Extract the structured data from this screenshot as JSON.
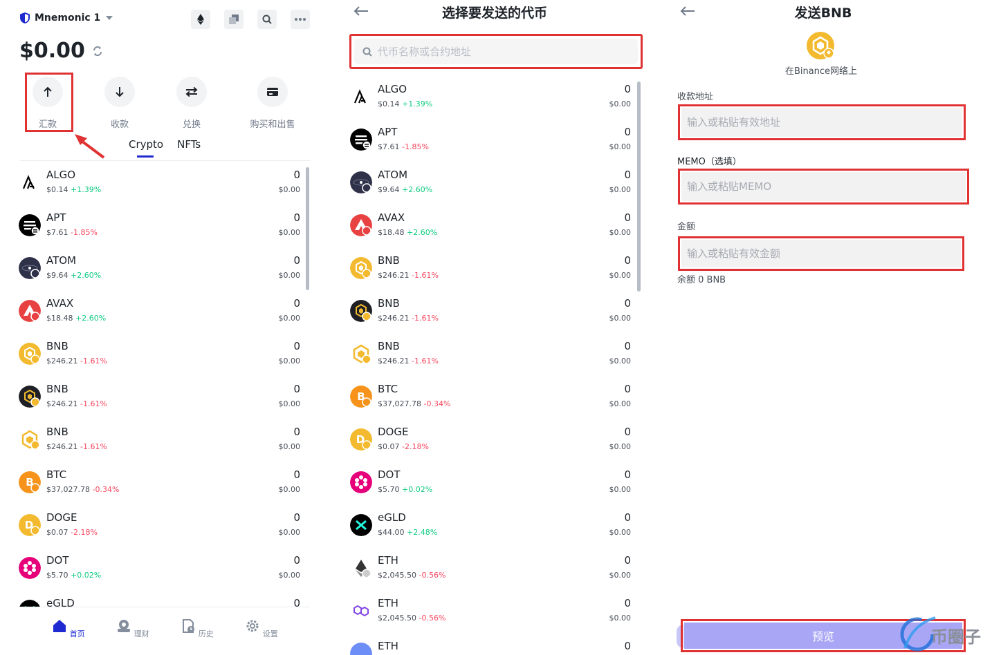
{
  "panel1": {
    "wallet_name": "Mnemonic 1",
    "balance": "$0.00",
    "actions": [
      {
        "label": "汇款"
      },
      {
        "label": "收款"
      },
      {
        "label": "兑换"
      },
      {
        "label": "购买和出售"
      }
    ],
    "tabs": [
      {
        "label": "Crypto",
        "active": true
      },
      {
        "label": "NFTs",
        "active": false
      }
    ],
    "coins": [
      {
        "sym": "ALGO",
        "price": "$0.14",
        "change": "+1.39%",
        "dir": "up",
        "amt": "0",
        "val": "$0.00",
        "icon": "algo-icon"
      },
      {
        "sym": "APT",
        "price": "$7.61",
        "change": "-1.85%",
        "dir": "down",
        "amt": "0",
        "val": "$0.00",
        "icon": "apt-icon"
      },
      {
        "sym": "ATOM",
        "price": "$9.64",
        "change": "+2.60%",
        "dir": "up",
        "amt": "0",
        "val": "$0.00",
        "icon": "atom-icon"
      },
      {
        "sym": "AVAX",
        "price": "$18.48",
        "change": "+2.60%",
        "dir": "up",
        "amt": "0",
        "val": "$0.00",
        "icon": "avax-icon"
      },
      {
        "sym": "BNB",
        "price": "$246.21",
        "change": "-1.61%",
        "dir": "down",
        "amt": "0",
        "val": "$0.00",
        "icon": "bnb-icon"
      },
      {
        "sym": "BNB",
        "price": "$246.21",
        "change": "-1.61%",
        "dir": "down",
        "amt": "0",
        "val": "$0.00",
        "icon": "bnb-dark-icon"
      },
      {
        "sym": "BNB",
        "price": "$246.21",
        "change": "-1.61%",
        "dir": "down",
        "amt": "0",
        "val": "$0.00",
        "icon": "bnb-outline-icon"
      },
      {
        "sym": "BTC",
        "price": "$37,027.78",
        "change": "-0.34%",
        "dir": "down",
        "amt": "0",
        "val": "$0.00",
        "icon": "btc-icon"
      },
      {
        "sym": "DOGE",
        "price": "$0.07",
        "change": "-2.18%",
        "dir": "down",
        "amt": "0",
        "val": "$0.00",
        "icon": "doge-icon"
      },
      {
        "sym": "DOT",
        "price": "$5.70",
        "change": "+0.02%",
        "dir": "up",
        "amt": "0",
        "val": "$0.00",
        "icon": "dot-icon"
      },
      {
        "sym": "eGLD",
        "price": "",
        "change": "",
        "dir": "up",
        "amt": "0",
        "val": "",
        "icon": "egld-icon"
      }
    ],
    "nav": [
      {
        "label": "首页",
        "icon": "home-icon",
        "active": true
      },
      {
        "label": "理财",
        "icon": "earn-icon",
        "active": false
      },
      {
        "label": "历史",
        "icon": "history-icon",
        "active": false
      },
      {
        "label": "设置",
        "icon": "settings-icon",
        "active": false
      }
    ]
  },
  "panel2": {
    "title": "选择要发送的代币",
    "search_placeholder": "代币名称或合约地址",
    "coins": [
      {
        "sym": "ALGO",
        "price": "$0.14",
        "change": "+1.39%",
        "dir": "up",
        "amt": "0",
        "val": "$0.00",
        "icon": "algo-icon"
      },
      {
        "sym": "APT",
        "price": "$7.61",
        "change": "-1.85%",
        "dir": "down",
        "amt": "0",
        "val": "$0.00",
        "icon": "apt-icon"
      },
      {
        "sym": "ATOM",
        "price": "$9.64",
        "change": "+2.60%",
        "dir": "up",
        "amt": "0",
        "val": "$0.00",
        "icon": "atom-icon"
      },
      {
        "sym": "AVAX",
        "price": "$18.48",
        "change": "+2.60%",
        "dir": "up",
        "amt": "0",
        "val": "$0.00",
        "icon": "avax-icon"
      },
      {
        "sym": "BNB",
        "price": "$246.21",
        "change": "-1.61%",
        "dir": "down",
        "amt": "0",
        "val": "$0.00",
        "icon": "bnb-icon"
      },
      {
        "sym": "BNB",
        "price": "$246.21",
        "change": "-1.61%",
        "dir": "down",
        "amt": "0",
        "val": "$0.00",
        "icon": "bnb-dark-icon"
      },
      {
        "sym": "BNB",
        "price": "$246.21",
        "change": "-1.61%",
        "dir": "down",
        "amt": "0",
        "val": "$0.00",
        "icon": "bnb-outline-icon"
      },
      {
        "sym": "BTC",
        "price": "$37,027.78",
        "change": "-0.34%",
        "dir": "down",
        "amt": "0",
        "val": "$0.00",
        "icon": "btc-icon"
      },
      {
        "sym": "DOGE",
        "price": "$0.07",
        "change": "-2.18%",
        "dir": "down",
        "amt": "0",
        "val": "$0.00",
        "icon": "doge-icon"
      },
      {
        "sym": "DOT",
        "price": "$5.70",
        "change": "+0.02%",
        "dir": "up",
        "amt": "0",
        "val": "$0.00",
        "icon": "dot-icon"
      },
      {
        "sym": "eGLD",
        "price": "$44.00",
        "change": "+2.48%",
        "dir": "up",
        "amt": "0",
        "val": "$0.00",
        "icon": "egld-icon"
      },
      {
        "sym": "ETH",
        "price": "$2,045.50",
        "change": "-0.56%",
        "dir": "down",
        "amt": "0",
        "val": "$0.00",
        "icon": "eth-icon"
      },
      {
        "sym": "ETH",
        "price": "$2,045.50",
        "change": "-0.56%",
        "dir": "down",
        "amt": "0",
        "val": "$0.00",
        "icon": "eth-polygon-icon"
      },
      {
        "sym": "ETH",
        "price": "",
        "change": "",
        "dir": "down",
        "amt": "0",
        "val": "",
        "icon": "eth-blue-icon"
      }
    ]
  },
  "panel3": {
    "title": "发送BNB",
    "network": "在Binance网络上",
    "address_label": "收款地址",
    "address_placeholder": "输入或粘贴有效地址",
    "memo_label": "MEMO（选填）",
    "memo_placeholder": "输入或粘贴MEMO",
    "amount_label": "金额",
    "amount_placeholder": "输入或粘贴有效金额",
    "balance_text": "余额 0 BNB",
    "preview_label": "预览",
    "watermark": "币圈子"
  },
  "colors": {
    "accent": "#1f2bd1",
    "highlight": "#e03232",
    "up": "#0ecb81",
    "down": "#f6465d",
    "preview": "#a9a6f5"
  }
}
